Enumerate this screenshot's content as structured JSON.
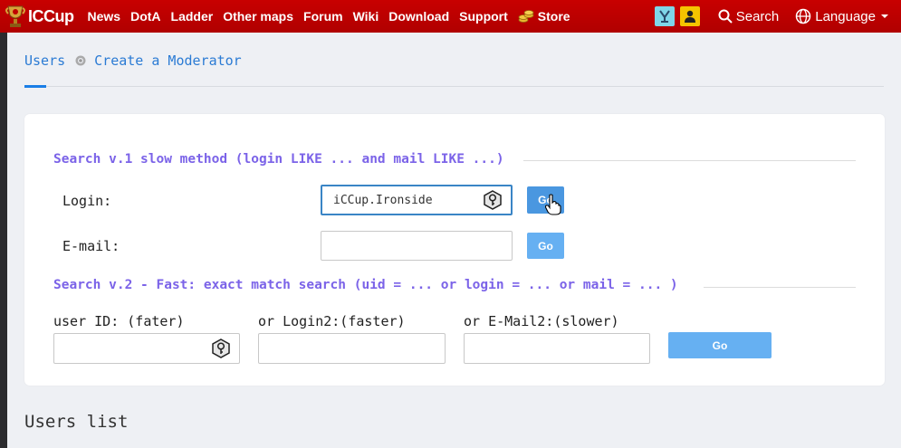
{
  "nav": {
    "logo_text": "ICCup",
    "items": [
      "News",
      "DotA",
      "Ladder",
      "Other maps",
      "Forum",
      "Wiki",
      "Download",
      "Support",
      "Store"
    ],
    "search_label": "Search",
    "language_label": "Language",
    "icons": [
      "trophy-logo-icon",
      "coins-icon",
      "game-icon",
      "user-icon",
      "search-icon",
      "globe-icon",
      "chevron-down-icon"
    ]
  },
  "breadcrumb": {
    "root": "Users",
    "current": "Create a Moderator"
  },
  "search_v1": {
    "legend": "Search v.1 slow method (login LIKE ... and mail LIKE ...)",
    "login_label": "Login:",
    "login_value": "iCCup.Ironside",
    "email_label": "E-mail:",
    "email_value": "",
    "go_label": "Go"
  },
  "search_v2": {
    "legend": "Search v.2 - Fast: exact match search (uid = ... or login = ... or mail = ... )",
    "uid_label": "user ID: (fater)",
    "login2_label": "or Login2:(faster)",
    "email2_label": "or E-Mail2:(slower)",
    "go_label": "Go"
  },
  "users_list_title": "Users list",
  "colors": {
    "nav_bg": "#c00000",
    "accent": "#1a7ee6",
    "legend": "#7b63e8",
    "button": "#66b0f2"
  }
}
